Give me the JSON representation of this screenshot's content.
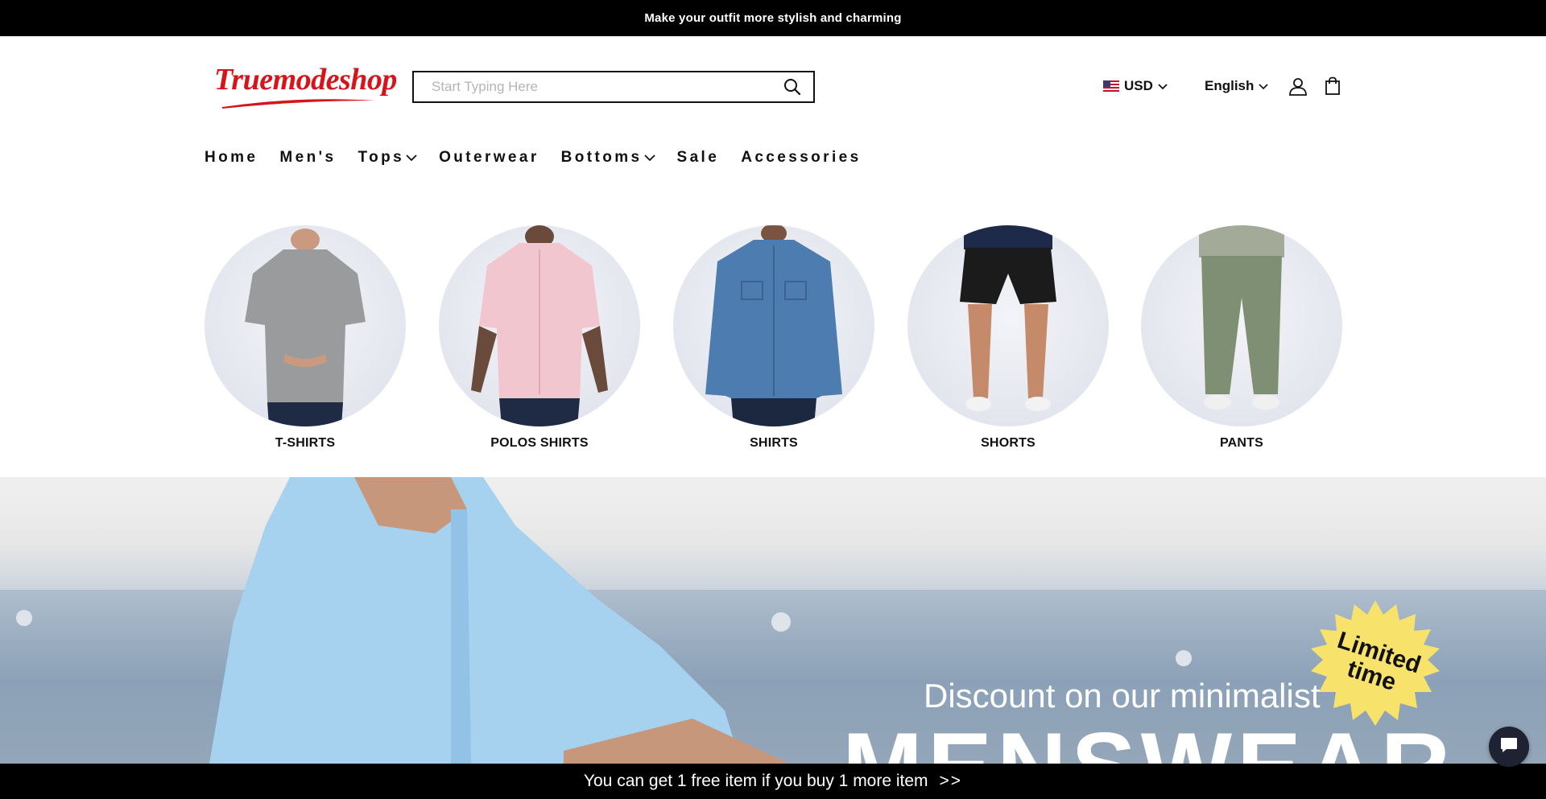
{
  "announcement": "Make your outfit more stylish and charming",
  "header": {
    "logo_text": "Truemodeshop",
    "search": {
      "placeholder": "Start Typing Here",
      "value": ""
    },
    "currency": "USD",
    "language": "English"
  },
  "nav": {
    "items": [
      {
        "label": "Home",
        "has_dropdown": false
      },
      {
        "label": "Men's",
        "has_dropdown": false
      },
      {
        "label": "Tops",
        "has_dropdown": true
      },
      {
        "label": "Outerwear",
        "has_dropdown": false
      },
      {
        "label": "Bottoms",
        "has_dropdown": true
      },
      {
        "label": "Sale",
        "has_dropdown": false
      },
      {
        "label": "Accessories",
        "has_dropdown": false
      }
    ]
  },
  "categories": [
    {
      "label": "T-SHIRTS"
    },
    {
      "label": "POLOS SHIRTS"
    },
    {
      "label": "SHIRTS"
    },
    {
      "label": "SHORTS"
    },
    {
      "label": "PANTS"
    }
  ],
  "hero": {
    "subtitle": "Discount on our minimalist",
    "headline": "MENSWEAR",
    "badge_line1": "Limited",
    "badge_line2": "time"
  },
  "promo_bar": {
    "text": "You can get 1 free item if you buy 1 more item",
    "arrows": ">>"
  },
  "colors": {
    "brand_red": "#d7141a",
    "badge_yellow": "#f7e26b",
    "bar_black": "#000000"
  },
  "icons": [
    "search-icon",
    "us-flag-icon",
    "chevron-down-icon",
    "user-icon",
    "shopping-bag-icon",
    "chat-icon"
  ]
}
